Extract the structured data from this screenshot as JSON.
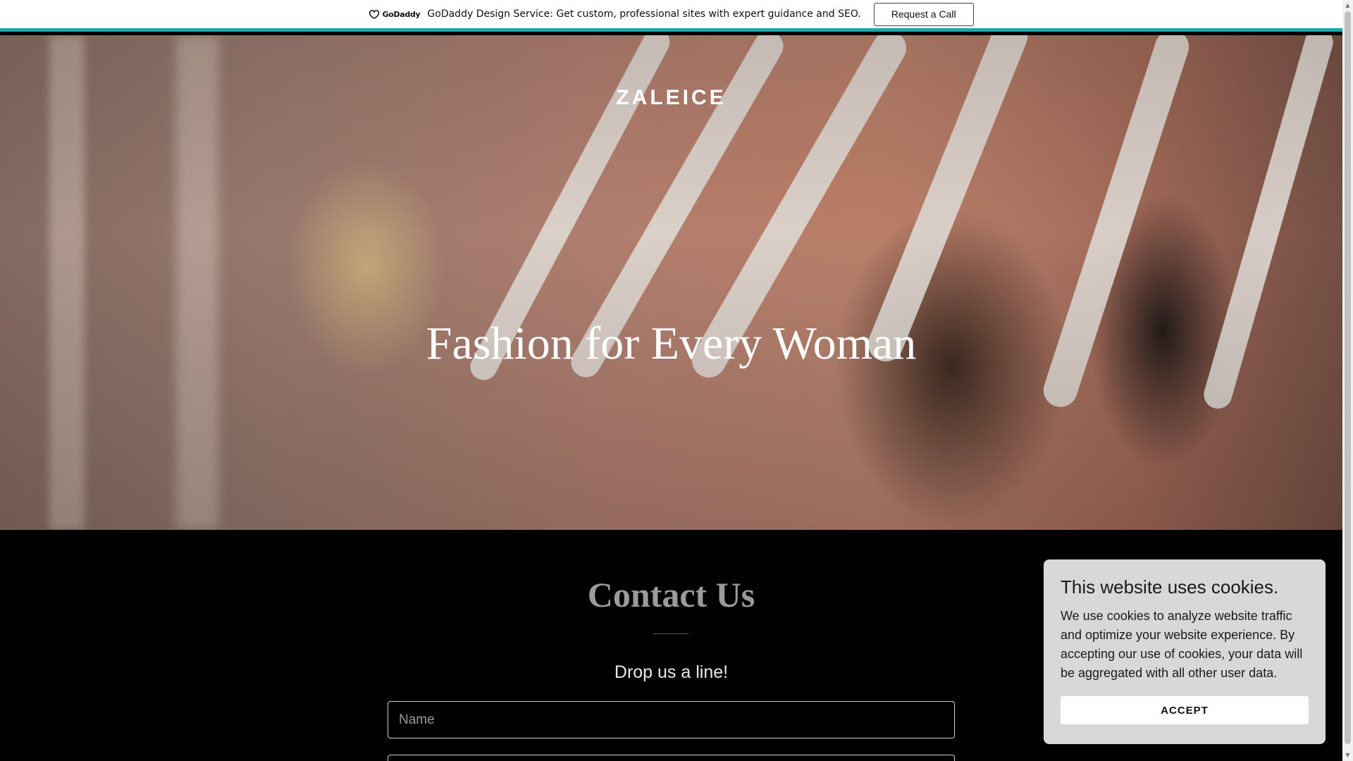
{
  "promo": {
    "logo_text": "GoDaddy",
    "logo_icon": "godaddy-logo-icon",
    "message": "GoDaddy Design Service: Get custom, professional sites with expert guidance and SEO.",
    "button_label": "Request a Call"
  },
  "hero": {
    "brand": "ZALEICE",
    "title": "Fashion for Every Woman"
  },
  "contact": {
    "title": "Contact Us",
    "subtitle": "Drop us a line!",
    "name_placeholder": "Name",
    "email_placeholder": ""
  },
  "cookie": {
    "title": "This website uses cookies.",
    "body": "We use cookies to analyze website traffic and optimize your website experience. By accepting our use of cookies, your data will be aggregated with all other user data.",
    "accept_label": "ACCEPT"
  },
  "colors": {
    "promo_accent": "#1ba8a8",
    "section_bg": "#000000",
    "cookie_bg": "#d8d8d8"
  }
}
